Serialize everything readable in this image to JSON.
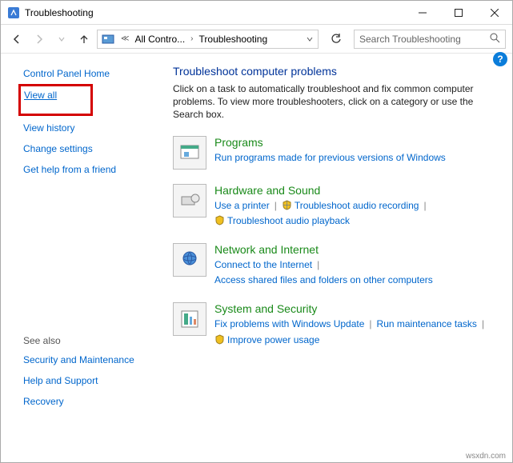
{
  "titlebar": {
    "title": "Troubleshooting"
  },
  "breadcrumb": {
    "seg1": "All Contro...",
    "seg2": "Troubleshooting"
  },
  "search": {
    "placeholder": "Search Troubleshooting"
  },
  "sidebar": {
    "home": "Control Panel Home",
    "view_all": "View all",
    "view_history": "View history",
    "change_settings": "Change settings",
    "get_help": "Get help from a friend",
    "see_also_hdr": "See also",
    "security": "Security and Maintenance",
    "help_support": "Help and Support",
    "recovery": "Recovery"
  },
  "main": {
    "heading": "Troubleshoot computer problems",
    "desc": "Click on a task to automatically troubleshoot and fix common computer problems. To view more troubleshooters, click on a category or use the Search box.",
    "cat1": {
      "title": "Programs",
      "l1": "Run programs made for previous versions of Windows"
    },
    "cat2": {
      "title": "Hardware and Sound",
      "l1": "Use a printer",
      "l2": "Troubleshoot audio recording",
      "l3": "Troubleshoot audio playback"
    },
    "cat3": {
      "title": "Network and Internet",
      "l1": "Connect to the Internet",
      "l2": "Access shared files and folders on other computers"
    },
    "cat4": {
      "title": "System and Security",
      "l1": "Fix problems with Windows Update",
      "l2": "Run maintenance tasks",
      "l3": "Improve power usage"
    }
  },
  "watermark": "wsxdn.com"
}
